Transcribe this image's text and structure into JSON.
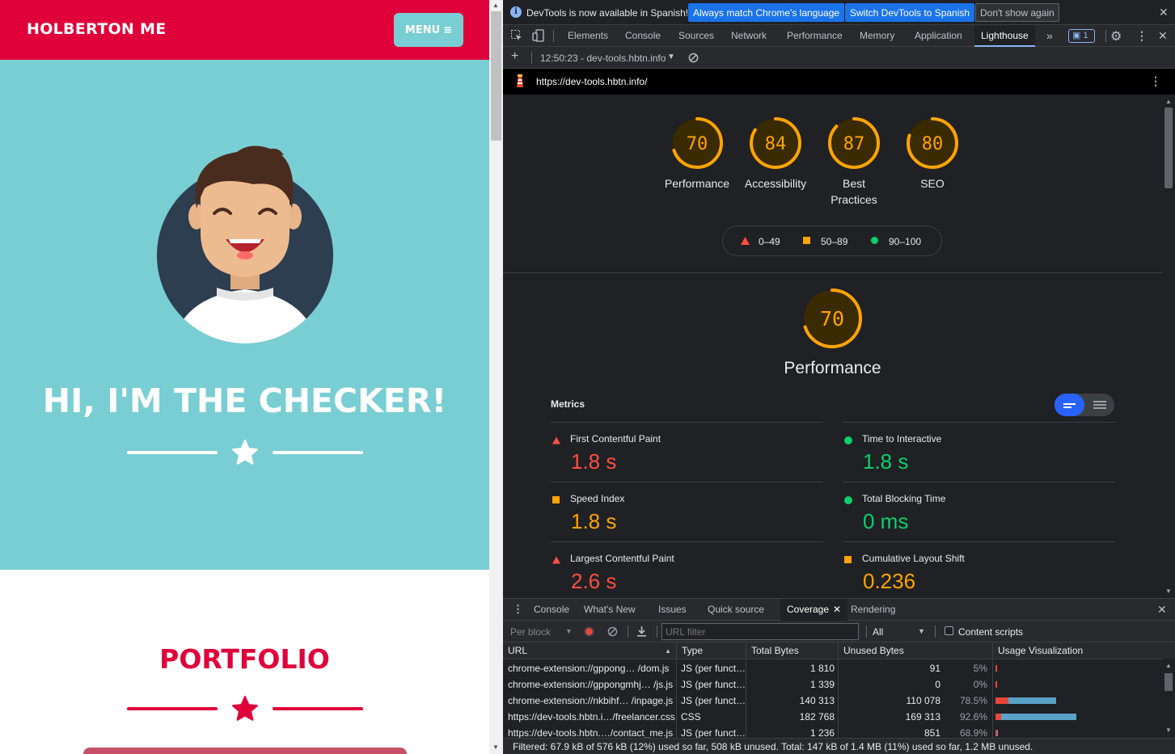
{
  "site": {
    "brand": "HOLBERTON ME",
    "menu_label": "MENU",
    "hero_title": "HI, I'M THE CHECKER!",
    "portfolio_title": "PORTFOLIO",
    "colors": {
      "primary": "#e0003a",
      "hero_bg": "#79ced3"
    }
  },
  "devtools": {
    "infobar": {
      "message": "DevTools is now available in Spanish!",
      "btn_match": "Always match Chrome's language",
      "btn_switch": "Switch DevTools to Spanish",
      "btn_dismiss": "Don't show again"
    },
    "tabs": [
      "Elements",
      "Console",
      "Sources",
      "Network",
      "Performance",
      "Memory",
      "Application",
      "Lighthouse"
    ],
    "active_tab": "Lighthouse",
    "issues_count": "1",
    "report_selector": "12:50:23 - dev-tools.hbtn.info",
    "report_url": "https://dev-tools.hbtn.info/",
    "lighthouse": {
      "scores": [
        {
          "label": "Performance",
          "value": 70
        },
        {
          "label": "Accessibility",
          "value": 84
        },
        {
          "label": "Best Practices",
          "value": 87
        },
        {
          "label": "SEO",
          "value": 80
        }
      ],
      "legend": [
        "0–49",
        "50–89",
        "90–100"
      ],
      "perf_score": 70,
      "perf_title": "Performance",
      "metrics_label": "Metrics",
      "metrics": [
        {
          "name": "First Contentful Paint",
          "value": "1.8 s",
          "status": "red"
        },
        {
          "name": "Time to Interactive",
          "value": "1.8 s",
          "status": "green"
        },
        {
          "name": "Speed Index",
          "value": "1.8 s",
          "status": "orange"
        },
        {
          "name": "Total Blocking Time",
          "value": "0 ms",
          "status": "green"
        },
        {
          "name": "Largest Contentful Paint",
          "value": "2.6 s",
          "status": "red"
        },
        {
          "name": "Cumulative Layout Shift",
          "value": "0.236",
          "status": "orange"
        }
      ]
    },
    "drawer_tabs": [
      "Console",
      "What's New",
      "Issues",
      "Quick source",
      "Coverage",
      "Rendering"
    ],
    "active_drawer_tab": "Coverage",
    "coverage": {
      "granularity": "Per block",
      "url_filter_placeholder": "URL filter",
      "type_filter": "All",
      "content_scripts_label": "Content scripts",
      "headers": [
        "URL",
        "Type",
        "Total Bytes",
        "Unused Bytes",
        "Usage Visualization"
      ],
      "rows": [
        {
          "url": "chrome-extension://gppong…  /dom.js",
          "type": "JS (per funct…",
          "total": "1 810",
          "unused": "91",
          "pct": "5%",
          "used_frac": 0.01,
          "unused_frac": 0.0005
        },
        {
          "url": "chrome-extension://gppongmhj…  /js.js",
          "type": "JS (per funct…",
          "total": "1 339",
          "unused": "0",
          "pct": "0%",
          "used_frac": 0.007,
          "unused_frac": 0.0
        },
        {
          "url": "chrome-extension://nkbihf…  /inpage.js",
          "type": "JS (per funct…",
          "total": "140 313",
          "unused": "110 078",
          "pct": "78.5%",
          "used_frac": 0.16,
          "unused_frac": 0.59
        },
        {
          "url": "https://dev-tools.hbtn.i…/freelancer.css",
          "type": "CSS",
          "total": "182 768",
          "unused": "169 313",
          "pct": "92.6%",
          "used_frac": 0.07,
          "unused_frac": 0.93
        },
        {
          "url": "https://dev-tools.hbtn.…/contact_me.js",
          "type": "JS (per funct…",
          "total": "1 236",
          "unused": "851",
          "pct": "68.9%",
          "used_frac": 0.002,
          "unused_frac": 0.004
        }
      ],
      "status": "Filtered: 67.9 kB of 576 kB (12%) used so far, 508 kB unused. Total: 147 kB of 1.4 MB (11%) used so far, 1.2 MB unused."
    }
  }
}
